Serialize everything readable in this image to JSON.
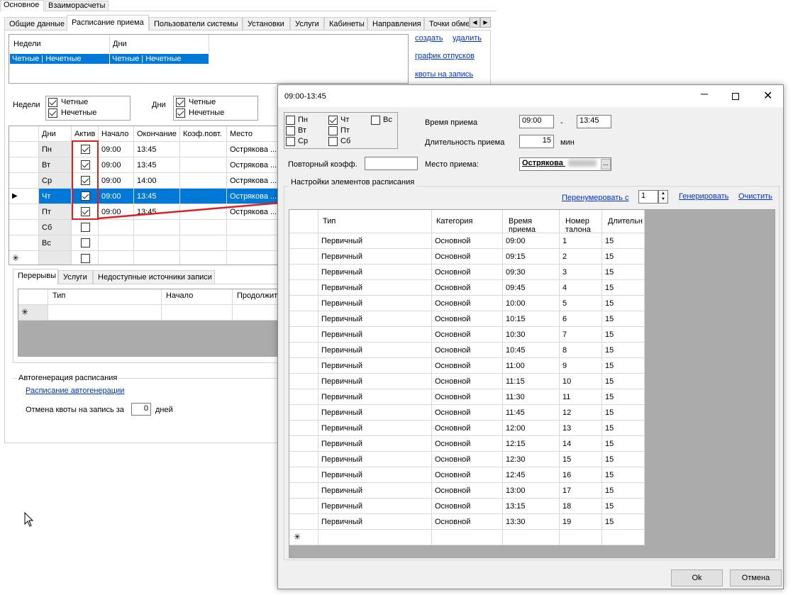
{
  "top_tabs": [
    "Основное",
    "Взаиморасчеты"
  ],
  "sub_tabs": [
    "Общие данные",
    "Расписание приема",
    "Пользователи системы",
    "Установки",
    "Услуги",
    "Кабинеты",
    "Направления",
    "Точки обме"
  ],
  "weeks_days_grid": {
    "headers": [
      "Недели",
      "Дни"
    ],
    "row": [
      "Четные | Нечетные",
      "Четные | Нечетные"
    ]
  },
  "links": {
    "create": "создать",
    "delete": "удалить",
    "vacations": "график отпусков",
    "quotas": "квоты на запись"
  },
  "filters": {
    "weeks_label": "Недели",
    "weeks_even": "Четные",
    "weeks_odd": "Нечетные",
    "days_label": "Дни",
    "days_even": "Четные",
    "days_odd": "Нечетные"
  },
  "schedule": {
    "headers": [
      "Дни",
      "Актив",
      "Начало",
      "Окончание",
      "Коэф.повт.",
      "Место"
    ],
    "rows": [
      {
        "day": "Пн",
        "active": true,
        "start": "09:00",
        "end": "13:45",
        "place": "Острякова ..."
      },
      {
        "day": "Вт",
        "active": true,
        "start": "09:00",
        "end": "13:45",
        "place": "Острякова ..."
      },
      {
        "day": "Ср",
        "active": true,
        "start": "09:00",
        "end": "14:00",
        "place": "Острякова ..."
      },
      {
        "day": "Чт",
        "active": true,
        "start": "09:00",
        "end": "13:45",
        "place": "Острякова ..."
      },
      {
        "day": "Пт",
        "active": true,
        "start": "09:00",
        "end": "13:45",
        "place": "Острякова ..."
      },
      {
        "day": "Сб",
        "active": false,
        "start": "",
        "end": "",
        "place": ""
      },
      {
        "day": "Вс",
        "active": false,
        "start": "",
        "end": "",
        "place": ""
      }
    ],
    "new_row_marker": "✳",
    "current_row_marker": "▶"
  },
  "lower_tabs": [
    "Перерывы",
    "Услуги",
    "Недоступные источники записи"
  ],
  "breaks_headers": [
    "Тип",
    "Начало",
    "Продолжит"
  ],
  "autogen": {
    "legend": "Автогенерация расписания",
    "link": "Расписание автогенерации",
    "cancel_label": "Отмена квоты на запись за",
    "cancel_value": "0",
    "cancel_unit": "дней"
  },
  "dialog": {
    "title": "09:00-13:45",
    "days": [
      {
        "label": "Пн",
        "checked": false
      },
      {
        "label": "Чт",
        "checked": true
      },
      {
        "label": "Вс",
        "checked": false
      },
      {
        "label": "Вт",
        "checked": false
      },
      {
        "label": "Пт",
        "checked": false
      },
      {
        "label": "Ср",
        "checked": false
      },
      {
        "label": "Сб",
        "checked": false
      }
    ],
    "time_label": "Время приема",
    "time_from": "09:00",
    "time_dash": "-",
    "time_to": "13:45",
    "duration_label": "Длительность приема",
    "duration_value": "15",
    "duration_unit": "мин",
    "repeat_label": "Повторный коэфф.",
    "repeat_value": "",
    "place_label": "Место приема:",
    "place_value": "Острякова",
    "place_button": "...",
    "settings_legend": "Настройки элементов расписания",
    "renumber_link": "Перенумеровать с",
    "renumber_value": "1",
    "generate_link": "Генерировать",
    "clear_link": "Очистить",
    "grid_headers": [
      "Тип",
      "Категория",
      "Время приема",
      "Номер талона",
      "Длительн"
    ],
    "grid_rows": [
      [
        "Первичный",
        "Основной",
        "09:00",
        "1",
        "15"
      ],
      [
        "Первичный",
        "Основной",
        "09:15",
        "2",
        "15"
      ],
      [
        "Первичный",
        "Основной",
        "09:30",
        "3",
        "15"
      ],
      [
        "Первичный",
        "Основной",
        "09:45",
        "4",
        "15"
      ],
      [
        "Первичный",
        "Основной",
        "10:00",
        "5",
        "15"
      ],
      [
        "Первичный",
        "Основной",
        "10:15",
        "6",
        "15"
      ],
      [
        "Первичный",
        "Основной",
        "10:30",
        "7",
        "15"
      ],
      [
        "Первичный",
        "Основной",
        "10:45",
        "8",
        "15"
      ],
      [
        "Первичный",
        "Основной",
        "11:00",
        "9",
        "15"
      ],
      [
        "Первичный",
        "Основной",
        "11:15",
        "10",
        "15"
      ],
      [
        "Первичный",
        "Основной",
        "11:30",
        "11",
        "15"
      ],
      [
        "Первичный",
        "Основной",
        "11:45",
        "12",
        "15"
      ],
      [
        "Первичный",
        "Основной",
        "12:00",
        "13",
        "15"
      ],
      [
        "Первичный",
        "Основной",
        "12:15",
        "14",
        "15"
      ],
      [
        "Первичный",
        "Основной",
        "12:30",
        "15",
        "15"
      ],
      [
        "Первичный",
        "Основной",
        "12:45",
        "16",
        "15"
      ],
      [
        "Первичный",
        "Основной",
        "13:00",
        "17",
        "15"
      ],
      [
        "Первичный",
        "Основной",
        "13:15",
        "18",
        "15"
      ],
      [
        "Первичный",
        "Основной",
        "13:30",
        "19",
        "15"
      ]
    ],
    "ok_label": "Ok",
    "cancel_label": "Отмена"
  },
  "colors": {
    "selection": "#0078d7",
    "link": "#0033cc",
    "highlight_box": "#e02020",
    "grid_empty": "#ababab"
  }
}
